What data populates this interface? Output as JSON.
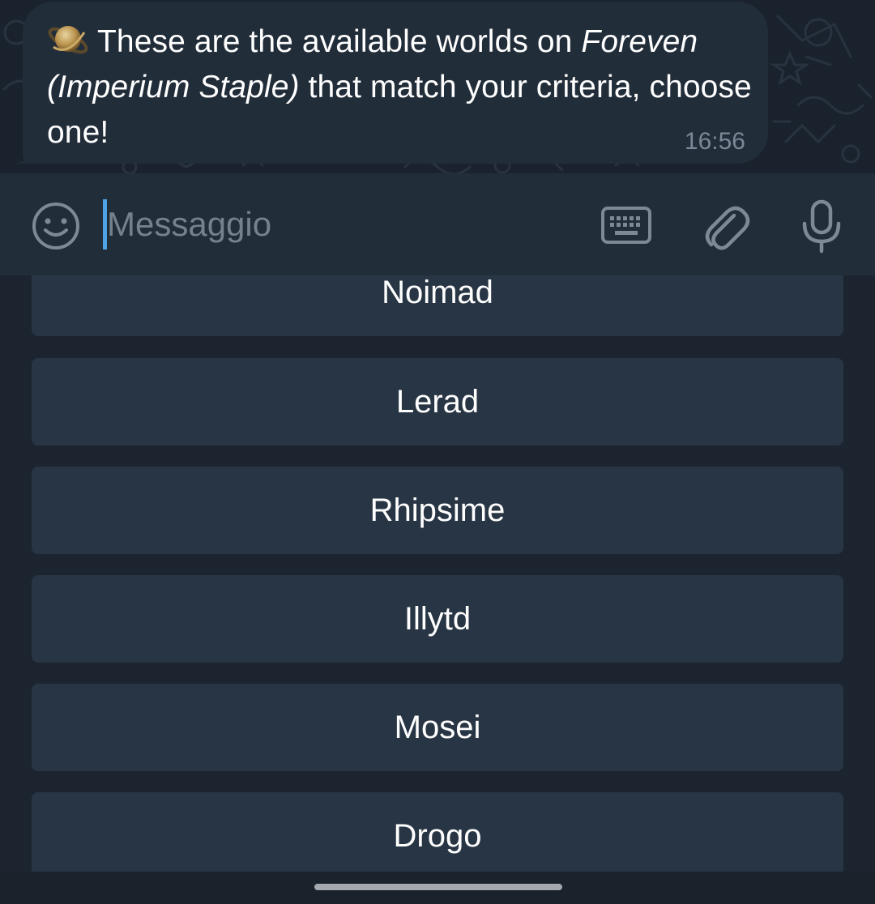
{
  "message": {
    "icon": "ringed-planet-icon",
    "text_before": "These are the available worlds on ",
    "text_italic": "Foreven (Imperium Staple)",
    "text_after": " that match your criteria, choose one!",
    "time": "16:56"
  },
  "input_bar": {
    "placeholder": "Messaggio",
    "emoji_icon": "smiley-icon",
    "keyboard_icon": "keyboard-icon",
    "attach_icon": "paperclip-icon",
    "mic_icon": "microphone-icon"
  },
  "reply_keyboard": {
    "buttons": [
      "Noimad",
      "Lerad",
      "Rhipsime",
      "Illytd",
      "Mosei",
      "Drogo"
    ]
  },
  "colors": {
    "background": "#1c2430",
    "bubble": "#222d3a",
    "button": "#283544",
    "caret": "#4fa3e4",
    "timestamp": "#7c8896",
    "icon": "#7e8996"
  }
}
